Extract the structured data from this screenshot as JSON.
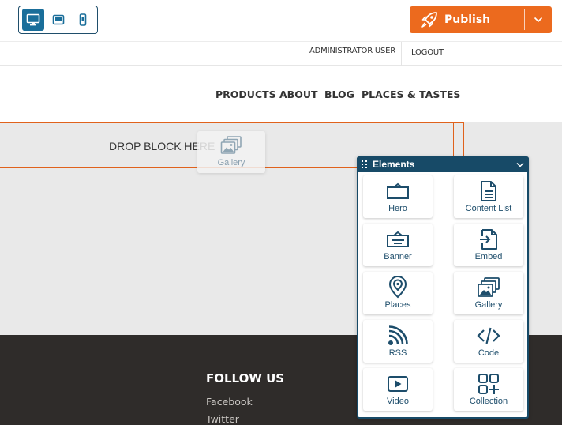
{
  "editor": {
    "devices": [
      {
        "name": "desktop",
        "active": true
      },
      {
        "name": "tablet",
        "active": false
      },
      {
        "name": "mobile",
        "active": false
      }
    ],
    "publish_label": "Publish"
  },
  "header": {
    "user_label": "ADMINISTRATOR USER",
    "logout_label": "LOGOUT"
  },
  "nav": {
    "items": [
      "PRODUCTS",
      "ABOUT",
      "BLOG",
      "PLACES & TASTES"
    ]
  },
  "canvas": {
    "drop_label": "DROP BLOCK HERE",
    "drag_ghost_label": "Gallery"
  },
  "footer": {
    "follow_title": "FOLLOW US",
    "links": [
      "Facebook",
      "Twitter"
    ]
  },
  "panel": {
    "title": "Elements",
    "items": [
      {
        "label": "Hero",
        "icon": "hero-icon"
      },
      {
        "label": "Content List",
        "icon": "content-list-icon"
      },
      {
        "label": "Banner",
        "icon": "banner-icon"
      },
      {
        "label": "Embed",
        "icon": "embed-icon"
      },
      {
        "label": "Places",
        "icon": "places-icon"
      },
      {
        "label": "Gallery",
        "icon": "gallery-icon"
      },
      {
        "label": "RSS",
        "icon": "rss-icon"
      },
      {
        "label": "Code",
        "icon": "code-icon"
      },
      {
        "label": "Video",
        "icon": "video-icon"
      },
      {
        "label": "Collection",
        "icon": "collection-icon"
      }
    ]
  },
  "colors": {
    "accent": "#ec6a1e",
    "panel_header": "#174a67",
    "icon": "#1d4d6b",
    "footer_bg": "#2f2c2a",
    "canvas_bg": "#e9e9e9"
  }
}
